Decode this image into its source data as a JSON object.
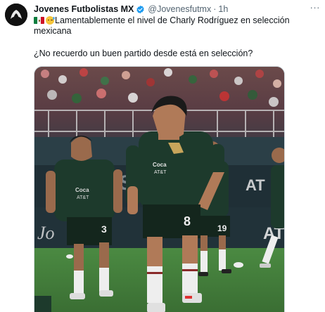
{
  "author": {
    "display_name": "Jovenes Futbolistas MX",
    "handle": "@Jovenesfutmx",
    "separator": "·",
    "time": "1h",
    "verified": true,
    "avatar_icon": "club-logo-avatar"
  },
  "menu_label": "···",
  "tweet": {
    "emojis": [
      "mexico-flag-icon",
      "sweat-smile-emoji-icon"
    ],
    "line1": "Lamentablemente el nivel de Charly Rodríguez en selección",
    "line2": "mexicana",
    "question": "¿No recuerdo un buen partido desde está en selección?"
  },
  "photo": {
    "description_icon": "mexico-players-warming-up-photo",
    "player_numbers": [
      "8",
      "3",
      "19"
    ],
    "colors": {
      "jersey": "#1d3a2c",
      "pitch": "#3e7a3a",
      "accent": "#c8a55b"
    }
  },
  "colors": {
    "text_primary": "#0f1419",
    "text_secondary": "#536471",
    "verified_blue": "#1d9bf0"
  }
}
